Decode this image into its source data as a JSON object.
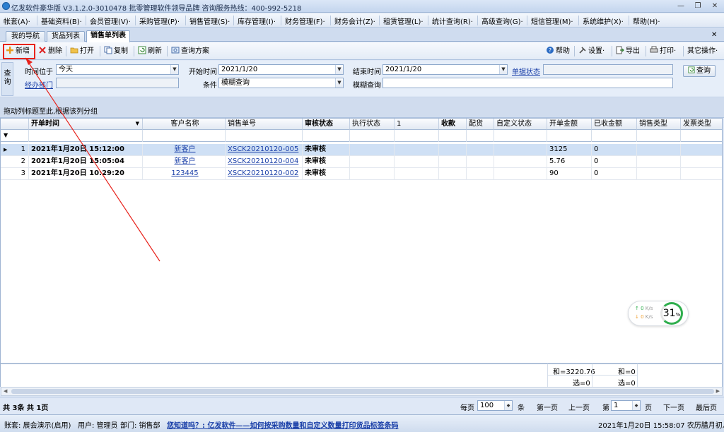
{
  "app": {
    "title": "亿发软件豪华版 V3.1.2.0-3010478 批零管理软件领导品牌 咨询服务热线：400-992-5218",
    "min": "—",
    "restore": "❐",
    "close": "✕"
  },
  "menu": [
    "帐套(A)·",
    "基础资料(B)·",
    "会员管理(V)·",
    "采购管理(P)·",
    "销售管理(S)·",
    "库存管理(I)·",
    "财务管理(F)·",
    "财务会计(Z)·",
    "租赁管理(L)·",
    "统计查询(R)·",
    "高级查询(G)·",
    "短信管理(M)·",
    "系统维护(X)·",
    "帮助(H)·"
  ],
  "tabs": [
    "我的导航",
    "货品列表",
    "销售单列表"
  ],
  "tabs_close": "✕",
  "toolbar": {
    "new": "新增",
    "delete": "删除",
    "open": "打开",
    "copy": "复制",
    "refresh": "刷新",
    "query_scheme": "查询方案",
    "help": "帮助",
    "settings": "设置·",
    "export": "导出",
    "print": "打印·",
    "other": "其它操作·"
  },
  "filter": {
    "side_label": "查询",
    "time_label": "时间位于",
    "time_value": "今天",
    "start_label": "开始时间",
    "start_value": "2021/1/20",
    "end_label": "结束时间",
    "end_value": "2021/1/20",
    "doc_status_label": "单据状态",
    "handler_label": "经办部门",
    "condition_label": "条件",
    "condition_value": "模糊查询",
    "fuzzy_label": "模糊查询",
    "query_button": "查询"
  },
  "group_hint": "拖动列标题至此,根据该列分组",
  "grid": {
    "columns": [
      "开单时间",
      "客户名称",
      "销售单号",
      "审核状态",
      "执行状态",
      "1",
      "收款",
      "配货",
      "自定义状态",
      "开单金额",
      "已收金额",
      "销售类型",
      "发票类型"
    ],
    "rows": [
      {
        "idx": "1",
        "time": "2021年1月20日 15:12:00",
        "customer": "新客户",
        "order": "XSCK20210120-005",
        "audit": "未审核",
        "amount": "3125",
        "received": "0"
      },
      {
        "idx": "2",
        "time": "2021年1月20日 15:05:04",
        "customer": "新客户",
        "order": "XSCK20210120-004",
        "audit": "未审核",
        "amount": "5.76",
        "received": "0"
      },
      {
        "idx": "3",
        "time": "2021年1月20日 10:29:20",
        "customer": "123445",
        "order": "XSCK20210120-002",
        "audit": "未审核",
        "amount": "90",
        "received": "0"
      }
    ]
  },
  "summary": {
    "amount_sum": "和=3220.76",
    "amount_sel": "选=0",
    "received_sum": "和=0",
    "received_sel": "选=0"
  },
  "net": {
    "up": "0",
    "down": "0",
    "unit": "K/s",
    "percent": "31",
    "pct": "%"
  },
  "pager": {
    "count": "共 3条 共 1页",
    "per_page_label": "每页",
    "per_page_value": "100",
    "per_page_unit": "条",
    "first": "第一页",
    "prev": "上一页",
    "page_label": "第",
    "page_value": "1",
    "page_unit": "页",
    "next": "下一页",
    "last": "最后页"
  },
  "status": {
    "account": "账套: 展会演示(启用)",
    "user": "用户: 管理员",
    "dept": "部门: 销售部",
    "tip": "您知道吗？: 亿发软件——如何按采购数量和自定义数量打印货品标签条码",
    "datetime": "2021年1月20日 15:58:07 农历腊月初八"
  },
  "colors": {
    "highlight": "#e8231c",
    "link": "#1a3fa8"
  }
}
